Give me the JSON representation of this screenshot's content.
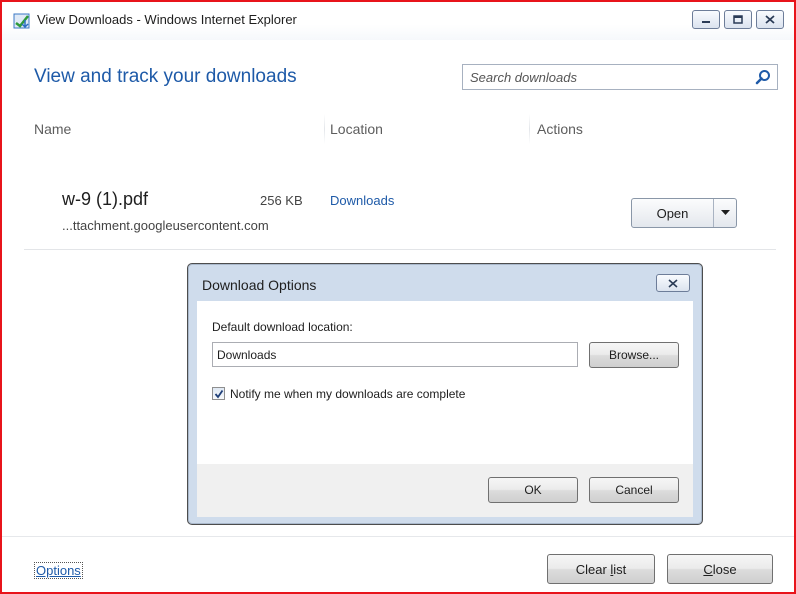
{
  "window": {
    "title": "View Downloads - Windows Internet Explorer",
    "minimize_icon": "minimize-icon",
    "maximize_icon": "maximize-icon",
    "close_icon": "close-icon"
  },
  "header": {
    "heading": "View and track your downloads",
    "search_placeholder": "Search downloads"
  },
  "columns": {
    "name": "Name",
    "location": "Location",
    "actions": "Actions"
  },
  "downloads": [
    {
      "file_name": "w-9 (1).pdf",
      "size": "256 KB",
      "source": "...ttachment.googleusercontent.com",
      "location": "Downloads",
      "action_label": "Open"
    }
  ],
  "dialog": {
    "title": "Download Options",
    "location_label": "Default download location:",
    "location_value": "Downloads",
    "browse_label": "Browse...",
    "notify_label": "Notify me when my downloads are complete",
    "notify_checked": true,
    "ok_label": "OK",
    "cancel_label": "Cancel"
  },
  "footer": {
    "options_link": "Options",
    "clear_list_prefix": "Clear ",
    "clear_list_access": "l",
    "clear_list_suffix": "ist",
    "close_access": "C",
    "close_suffix": "lose"
  },
  "colors": {
    "accent": "#1e5aa8",
    "window_border": "#e8141b",
    "dialog_frame": "#cfdcec"
  }
}
